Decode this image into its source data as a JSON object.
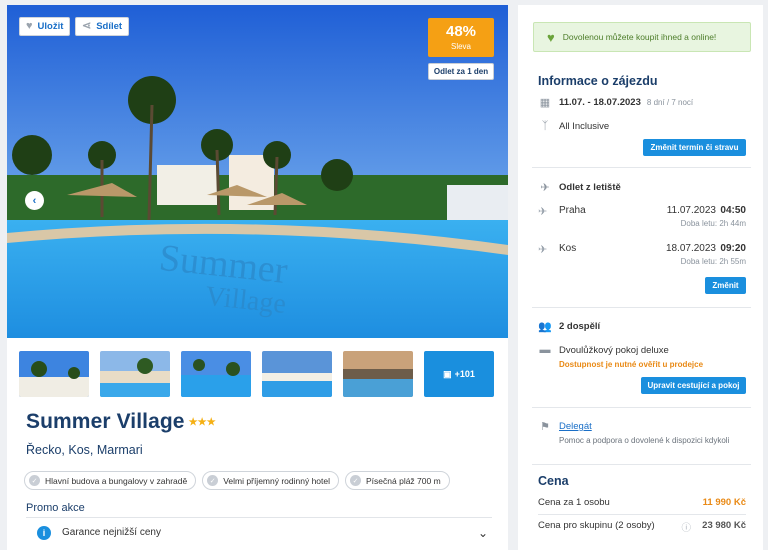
{
  "toolbar": {
    "save_label": "Uložit",
    "share_label": "Sdílet"
  },
  "badge": {
    "discount": "48%",
    "discount_label": "Sleva",
    "departure": "Odlet za 1 den"
  },
  "gallery": {
    "more_label": "+101"
  },
  "hotel": {
    "name": "Summer Village",
    "stars": "★★★",
    "location": "Řecko, Kos, Marmari"
  },
  "features": [
    "Hlavní budova a bungalovy v zahradě",
    "Velmi příjemný rodinný hotel",
    "Písečná pláž 700 m"
  ],
  "promo": {
    "title": "Promo akce",
    "item": "Garance nejnižší ceny"
  },
  "notice": "Dovolenou můžete koupit ihned a online!",
  "info": {
    "title": "Informace o zájezdu",
    "dates": "11.07. - 18.07.2023",
    "length": "8 dní / 7 nocí",
    "board": "All Inclusive",
    "change_btn": "Změnit termín či stravu"
  },
  "flights": {
    "title": "Odlet z letiště",
    "out": {
      "city": "Praha",
      "date": "11.07.2023",
      "time": "04:50",
      "duration": "Doba letu: 2h 44m"
    },
    "back": {
      "city": "Kos",
      "date": "18.07.2023",
      "time": "09:20",
      "duration": "Doba letu: 2h 55m"
    },
    "change_btn": "Změnit"
  },
  "travellers": {
    "count": "2 dospělí",
    "room": "Dvoulůžkový pokoj deluxe",
    "warning": "Dostupnost je nutné ověřit u prodejce",
    "edit_btn": "Upravit cestující a pokoj"
  },
  "delegate": {
    "title": "Delegát",
    "text": "Pomoc a podpora o dovolené k dispozici kdykoli"
  },
  "price": {
    "title": "Cena",
    "per_person_label": "Cena za 1 osobu",
    "per_person_value": "11 990 Kč",
    "group_label": "Cena pro skupinu (2 osoby)",
    "group_value": "23 980 Kč"
  },
  "colors": {
    "accent": "#1a8fde",
    "brand": "#1b3e6a",
    "discount": "#f5a014",
    "price": "#e98a16"
  }
}
